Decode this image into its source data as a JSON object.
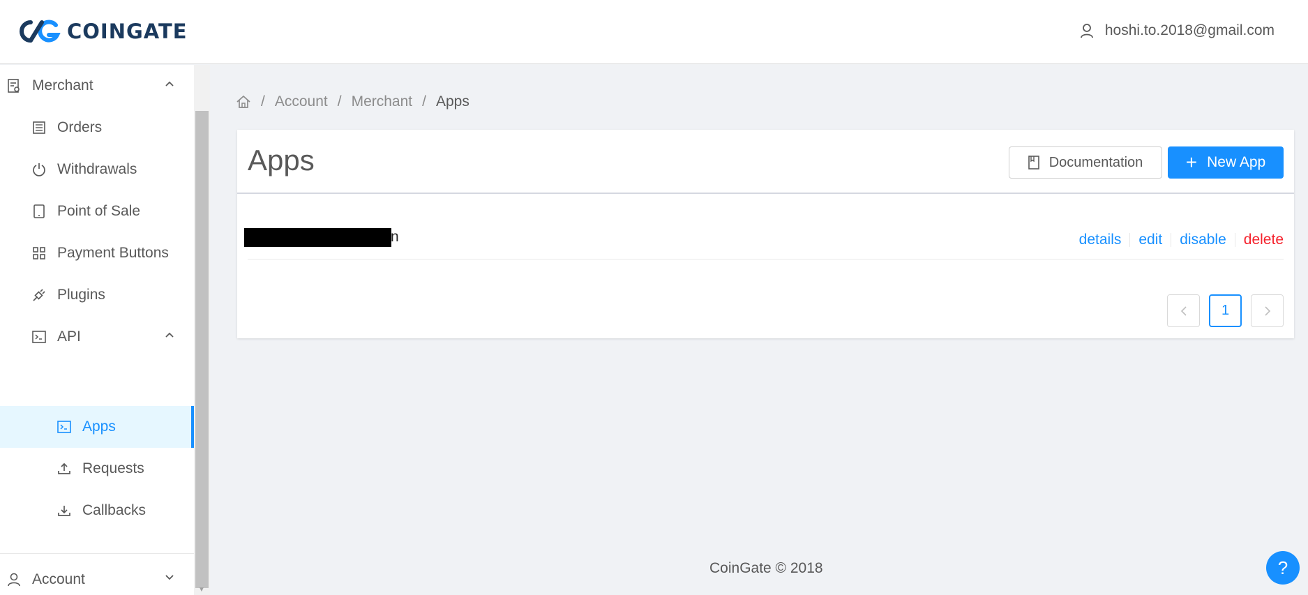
{
  "brand": {
    "name": "COINGATE",
    "color": "#1b3a5e",
    "accent": "#1890ff"
  },
  "user": {
    "email": "hoshi.to.2018@gmail.com",
    "icon": "user-icon"
  },
  "sidebar": {
    "merchant": {
      "label": "Merchant",
      "icon": "merchant-icon"
    },
    "items": [
      {
        "label": "Orders",
        "icon": "orders-icon"
      },
      {
        "label": "Withdrawals",
        "icon": "power-icon"
      },
      {
        "label": "Point of Sale",
        "icon": "tablet-icon"
      },
      {
        "label": "Payment Buttons",
        "icon": "grid-icon"
      },
      {
        "label": "Plugins",
        "icon": "plug-icon"
      }
    ],
    "api": {
      "label": "API",
      "icon": "terminal-icon"
    },
    "api_items": [
      {
        "label": "Apps",
        "icon": "terminal-icon",
        "active": true
      },
      {
        "label": "Requests",
        "icon": "upload-icon"
      },
      {
        "label": "Callbacks",
        "icon": "download-icon"
      }
    ],
    "account": {
      "label": "Account",
      "icon": "user-icon"
    }
  },
  "breadcrumb": {
    "items": [
      "Account",
      "Merchant",
      "Apps"
    ],
    "separator": "/"
  },
  "card": {
    "title": "Apps",
    "doc_button": "Documentation",
    "new_button": "New App",
    "new_button_plus": "+",
    "rows": [
      {
        "name_tail": "n",
        "actions": {
          "details": "details",
          "edit": "edit",
          "disable": "disable",
          "delete": "delete"
        }
      }
    ],
    "pagination": {
      "current": "1"
    }
  },
  "footer": {
    "text": "CoinGate © 2018"
  },
  "help": {
    "label": "?"
  }
}
